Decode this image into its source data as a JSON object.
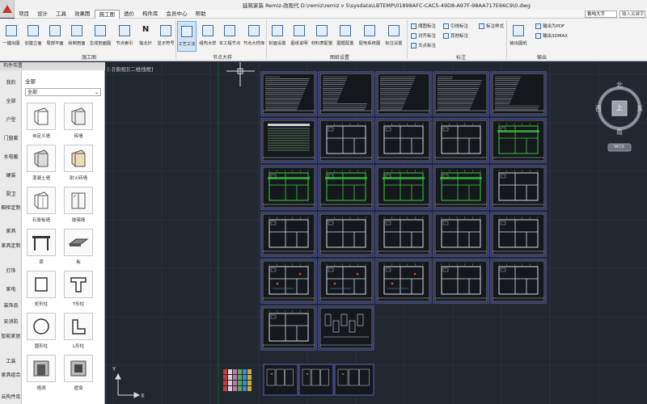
{
  "window": {
    "title": "延筑家装 Remiz-改现代    D:\\remiz\\remiz v 5\\sysdata\\LBTEMP\\01898AFC-CAC5-49D8-A97F-98AA717E66C9\\0.dwg"
  },
  "menu": {
    "items": [
      "项目",
      "设计",
      "工具",
      "效果图",
      "施工图",
      "透价",
      "构件库",
      "会员中心",
      "帮助"
    ],
    "active_index": 4,
    "search_select": "鲁吨大字",
    "search_placeholder": "输入关键字"
  },
  "ribbon": {
    "buttons": [
      {
        "label": "一键出图"
      },
      {
        "label": "创建立面"
      },
      {
        "label": "局部平面"
      },
      {
        "label": "绘制剖面"
      },
      {
        "label": "生成剖面图"
      },
      {
        "label": "节点索引"
      },
      {
        "label": "指北针"
      },
      {
        "label": "显示符号"
      },
      {
        "label": "工艺工法"
      },
      {
        "label": "组构大样"
      },
      {
        "label": "本工程节点"
      },
      {
        "label": "节点大样库"
      },
      {
        "label": "封面设置"
      },
      {
        "label": "图纸说明"
      },
      {
        "label": "材料表配置"
      },
      {
        "label": "图框配置"
      },
      {
        "label": "配电系统图"
      },
      {
        "label": "标注设置"
      }
    ],
    "small_buttons": [
      "阈图标注",
      "对齐标注",
      "文点标注",
      "引线标注",
      "其他标注",
      "标注样式",
      "输出图纸",
      "输出为PDF",
      "输出3DMAX"
    ],
    "groups": [
      "施工图",
      "节点大样",
      "图纸设置",
      "标注",
      "输出"
    ]
  },
  "palette": {
    "title": "构件布置",
    "categories": [
      "我的",
      "全部",
      "户型",
      "门窗套",
      "水电暖",
      "硬装",
      "厨卫",
      "橱柜定制",
      "家具",
      "家具定制",
      "灯饰",
      "家电",
      "装饰品",
      "安消防",
      "智能家居",
      "工装",
      "家具组合",
      "云构件库"
    ],
    "header": "全部",
    "filter": "全部",
    "tiles": [
      {
        "label": "自定义墙"
      },
      {
        "label": "砖墙"
      },
      {
        "label": "混凝土墙"
      },
      {
        "label": "耐火砖墙"
      },
      {
        "label": "石膏板墙"
      },
      {
        "label": "玻璃墙"
      },
      {
        "label": "梁"
      },
      {
        "label": "板"
      },
      {
        "label": "矩形柱"
      },
      {
        "label": "T形柱"
      },
      {
        "label": "圆形柱"
      },
      {
        "label": "L形柱"
      },
      {
        "label": "墙洞"
      },
      {
        "label": "壁龛"
      }
    ]
  },
  "canvas": {
    "viewport_label": "[-][俯视][二维线框]",
    "compass": {
      "north": "北",
      "south": "南",
      "east": "东",
      "west": "西",
      "center": "上",
      "wcs": "WCS"
    },
    "ucs_y": "Y",
    "ucs_x": "X"
  },
  "colors": {
    "canvas_bg": "#212830",
    "sheet_border": "#5a61c8",
    "sheet_bg": "#14171c",
    "drawing_white": "#d8dde6",
    "plan_green": "#3ecf3e",
    "plan_red": "#e04040"
  }
}
